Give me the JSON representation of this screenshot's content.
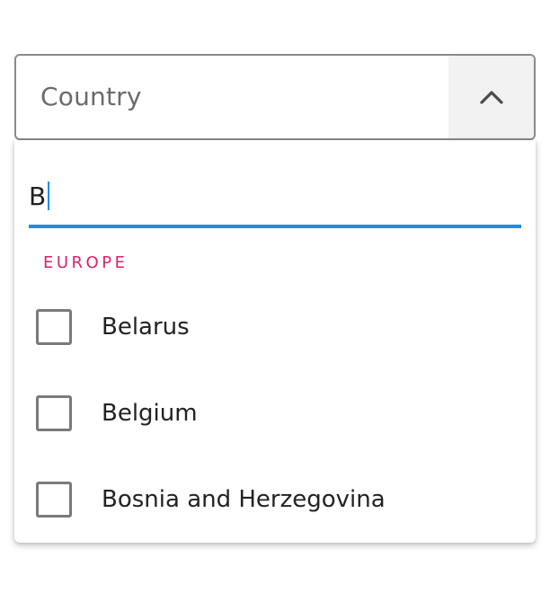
{
  "select": {
    "label": "Country",
    "expanded": true
  },
  "search": {
    "value": "B",
    "placeholder": ""
  },
  "group": {
    "label": "EUROPE"
  },
  "options": [
    {
      "label": "Belarus",
      "checked": false
    },
    {
      "label": "Belgium",
      "checked": false
    },
    {
      "label": "Bosnia and Herzegovina",
      "checked": false
    }
  ],
  "colors": {
    "accent": "#1e8ee6",
    "group_header": "#d6246e",
    "border": "#8a8a8a",
    "toggle_bg": "#f2f2f2"
  },
  "icons": {
    "toggle": "chevron-up-icon"
  }
}
